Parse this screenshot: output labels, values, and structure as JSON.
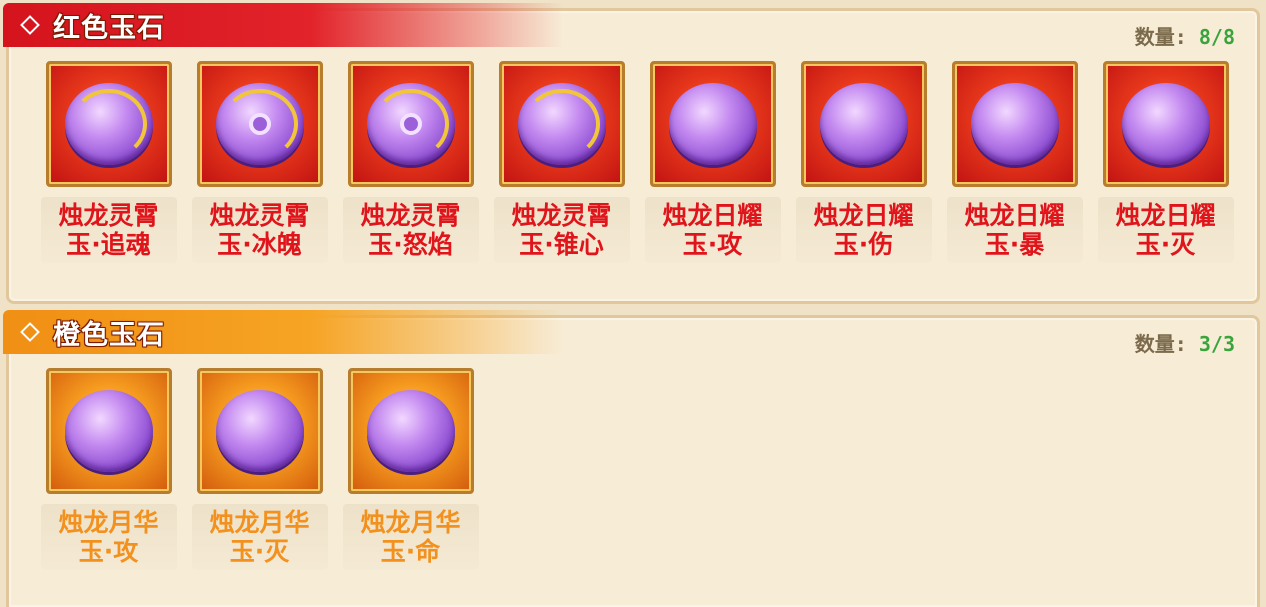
{
  "sections": [
    {
      "title": "红色玉石",
      "count_label": "数量:",
      "count_value": "8/8",
      "items": [
        {
          "line1": "烛龙灵霄",
          "line2": "玉·追魂",
          "icon": "dragon-jade-swirl-icon"
        },
        {
          "line1": "烛龙灵霄",
          "line2": "玉·冰魄",
          "icon": "dragon-jade-ring-icon"
        },
        {
          "line1": "烛龙灵霄",
          "line2": "玉·怒焰",
          "icon": "dragon-jade-coil-icon"
        },
        {
          "line1": "烛龙灵霄",
          "line2": "玉·锥心",
          "icon": "dragon-jade-serpent-icon"
        },
        {
          "line1": "烛龙日耀",
          "line2": "玉·攻",
          "icon": "dragon-orb-jade-icon"
        },
        {
          "line1": "烛龙日耀",
          "line2": "玉·伤",
          "icon": "dragon-orb-jade-icon"
        },
        {
          "line1": "烛龙日耀",
          "line2": "玉·暴",
          "icon": "dragon-orb-jade-icon"
        },
        {
          "line1": "烛龙日耀",
          "line2": "玉·灭",
          "icon": "dragon-orb-jade-icon"
        }
      ]
    },
    {
      "title": "橙色玉石",
      "count_label": "数量:",
      "count_value": "3/3",
      "items": [
        {
          "line1": "烛龙月华",
          "line2": "玉·攻",
          "icon": "dragon-orb-jade-icon"
        },
        {
          "line1": "烛龙月华",
          "line2": "玉·灭",
          "icon": "dragon-orb-jade-icon"
        },
        {
          "line1": "烛龙月华",
          "line2": "玉·命",
          "icon": "dragon-orb-jade-icon"
        }
      ]
    }
  ],
  "colors": {
    "red_header": "#d5131d",
    "orange_header": "#f08f14",
    "red_text": "#e0141b",
    "orange_text": "#f2911e",
    "count_value": "#3aa43c"
  }
}
